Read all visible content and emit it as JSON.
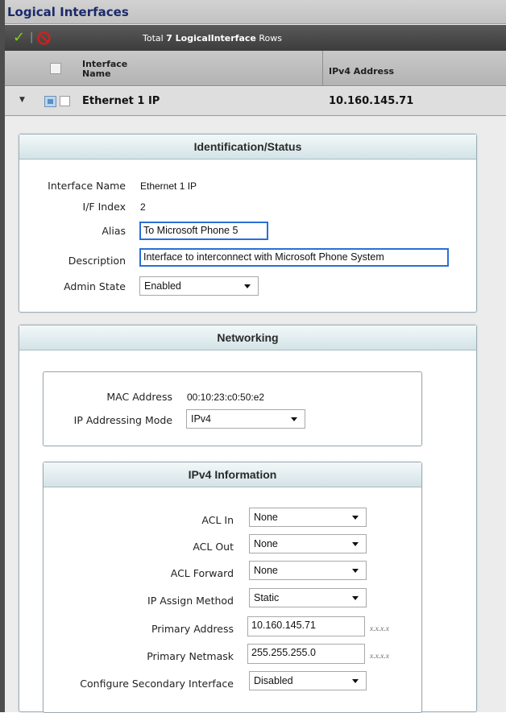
{
  "header": {
    "title": "Logical Interfaces"
  },
  "toolbar": {
    "total_prefix": "Total ",
    "total_count": "7",
    "total_entity": " LogicalInterface",
    "total_suffix": " Rows",
    "accept_icon": "checkmark-icon",
    "cancel_icon": "no-entry-icon"
  },
  "grid": {
    "columns": [
      "Interface Name",
      "IPv4 Address"
    ],
    "rows": [
      {
        "name": "Ethernet 1 IP",
        "ipv4": "10.160.145.71"
      }
    ]
  },
  "identification": {
    "title": "Identification/Status",
    "labels": {
      "interface_name": "Interface Name",
      "if_index": "I/F Index",
      "alias": "Alias",
      "description": "Description",
      "admin_state": "Admin State"
    },
    "values": {
      "interface_name": "Ethernet 1 IP",
      "if_index": "2",
      "alias": "To Microsoft Phone 5",
      "description": "Interface to interconnect with Microsoft Phone System",
      "admin_state": "Enabled"
    }
  },
  "networking": {
    "title": "Networking",
    "labels": {
      "mac": "MAC Address",
      "mode": "IP Addressing Mode"
    },
    "values": {
      "mac": "00:10:23:c0:50:e2",
      "mode": "IPv4"
    }
  },
  "ipv4": {
    "title": "IPv4 Information",
    "labels": {
      "acl_in": "ACL In",
      "acl_out": "ACL Out",
      "acl_forward": "ACL Forward",
      "assign_method": "IP Assign Method",
      "primary_address": "Primary Address",
      "primary_netmask": "Primary Netmask",
      "secondary": "Configure Secondary Interface"
    },
    "values": {
      "acl_in": "None",
      "acl_out": "None",
      "acl_forward": "None",
      "assign_method": "Static",
      "primary_address": "10.160.145.71",
      "primary_netmask": "255.255.255.0",
      "secondary": "Disabled"
    },
    "format_hint": "x.x.x.x"
  },
  "colors": {
    "title_text": "#1b2a6b",
    "toolbar_bg": "#4a4a4a",
    "focus_border": "#2a6fd6",
    "accept_green": "#7cd318",
    "cancel_red": "#d0201b"
  }
}
